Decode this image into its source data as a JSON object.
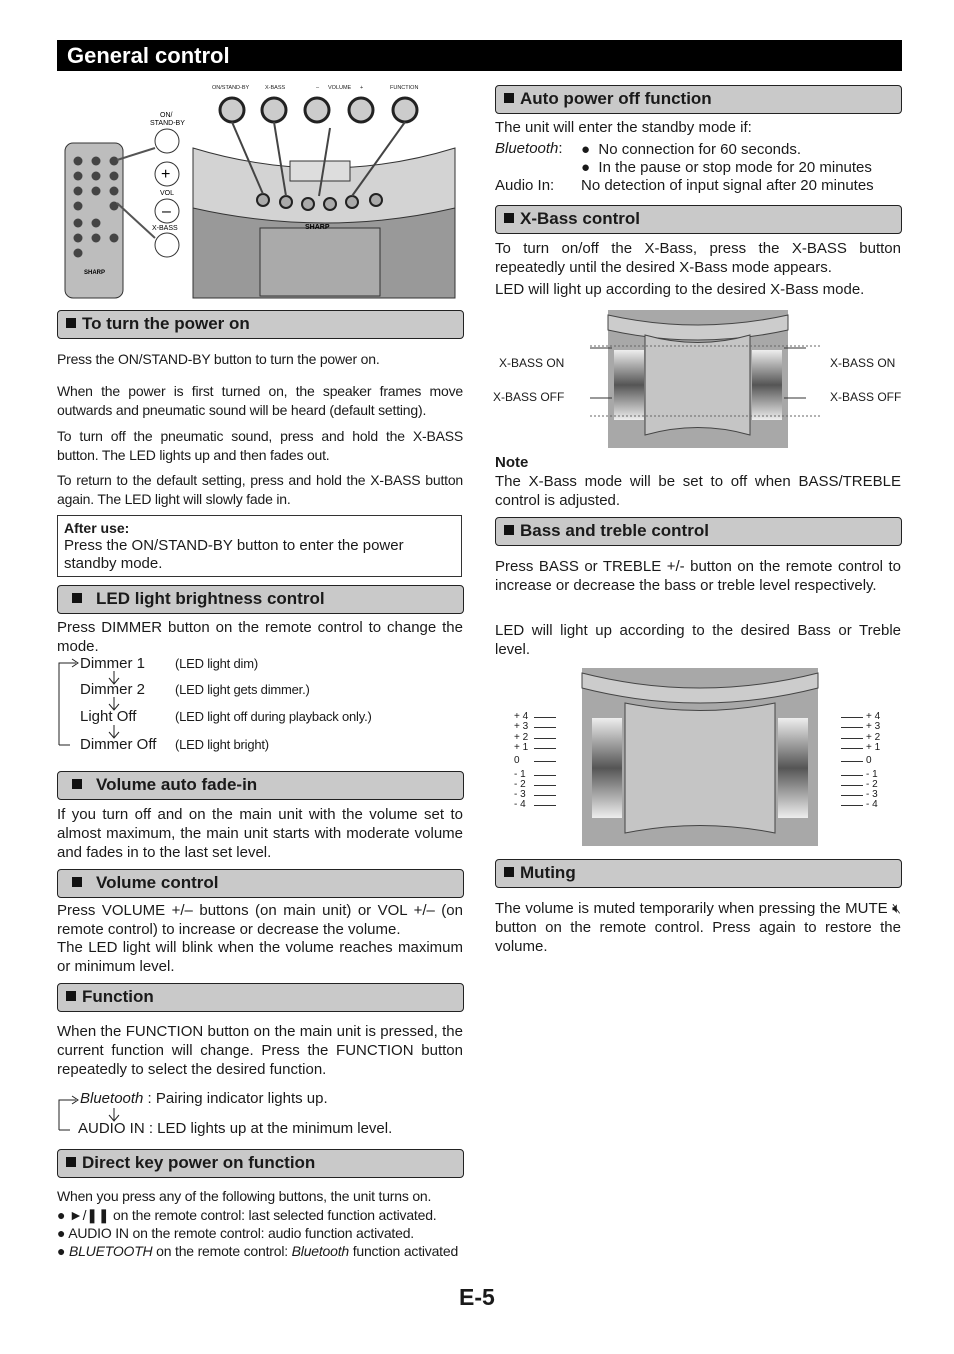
{
  "title": "General control",
  "illustration": {
    "top_labels": [
      "ON/STAND-BY",
      "X-BASS",
      "–",
      "VOLUME",
      "+",
      "FUNCTION"
    ],
    "remote_labels": [
      "ON/\nSTAND-BY",
      "VOL",
      "X-BASS"
    ],
    "brand": "SHARP"
  },
  "power_on": {
    "heading": "To turn the power on",
    "p1": "Press the ON/STAND-BY button to turn the power on.",
    "p2": "When the power is first turned on, the speaker frames move outwards and pneumatic sound will be heard (default setting).",
    "p3": "To turn off the pneumatic sound, press and hold the X-BASS button. The LED lights up and then fades out.",
    "p4": "To return to the default setting, press and hold the X-BASS button again. The LED light will slowly fade in.",
    "after_title": "After use:",
    "after_text": "Press the ON/STAND-BY button to enter the power standby mode."
  },
  "led": {
    "heading": "LED light brightness control",
    "p1": "Press DIMMER button on the remote control to change the mode.",
    "modes": [
      {
        "name": "Dimmer 1",
        "desc": "(LED light dim)"
      },
      {
        "name": "Dimmer 2",
        "desc": "(LED light gets dimmer.)"
      },
      {
        "name": "Light Off",
        "desc": "(LED light off during playback only.)"
      },
      {
        "name": "Dimmer Off",
        "desc": "(LED light bright)"
      }
    ]
  },
  "fade": {
    "heading": "Volume auto fade-in",
    "p1": "If you turn off and on the main unit with the volume set to almost maximum, the main unit starts with moderate volume and fades in to the last set level."
  },
  "volume": {
    "heading": "Volume control",
    "p1": "Press VOLUME +/– buttons (on main unit) or VOL +/– (on remote control) to increase or decrease the volume.",
    "p2": "The LED light will blink when the volume reaches maximum or minimum level."
  },
  "function": {
    "heading": "Function",
    "p1": "When the FUNCTION button on the main unit is pressed, the current function will change. Press the FUNCTION button repeatedly to select the desired function.",
    "bt_name": "Bluetooth",
    "bt_desc": " : Pairing indicator lights up.",
    "audio": "AUDIO IN : LED lights up at the minimum level."
  },
  "direct": {
    "heading": "Direct key power on function",
    "p1": "When you press any of the following buttons, the unit turns on.",
    "b1": "►/❚❚ on the remote control: last selected function activated.",
    "b2": "AUDIO IN on the remote control: audio function activated.",
    "b3a": "BLUETOOTH",
    "b3b": " on the remote control: ",
    "b3c": "Bluetooth",
    "b3d": " function activated"
  },
  "auto_off": {
    "heading": "Auto power off function",
    "p1": "The unit will enter the standby mode if:",
    "bt_label": "Bluetooth",
    "bt_colon": ":",
    "bt1": "No connection for 60 seconds.",
    "bt2": "In the pause or stop mode for 20 minutes",
    "ai_label": "Audio In:",
    "ai_text": "No detection of input signal after 20 minutes"
  },
  "xbass": {
    "heading": "X-Bass control",
    "p1": "To turn on/off the X-Bass, press the X-BASS button repeatedly until the desired X-Bass mode appears.",
    "p2": "LED will light up according to the desired X-Bass mode.",
    "on": "X-BASS ON",
    "off": "X-BASS OFF",
    "note_title": "Note",
    "note": "The X-Bass mode will be set to off when BASS/TREBLE control is adjusted."
  },
  "bass": {
    "heading": "Bass and treble control",
    "p1": "Press BASS or TREBLE +/- button on the remote control to increase or decrease the bass or treble level respectively.",
    "p2": "LED will light up according to the desired Bass or Treble level.",
    "levels": [
      "+ 4",
      "+ 3",
      "+ 2",
      "+ 1",
      "0",
      "- 1",
      "- 2",
      "- 3",
      "- 4"
    ]
  },
  "muting": {
    "heading": "Muting",
    "p1a": "The volume is muted temporarily when pressing the MUTE ",
    "p1b": " button on the remote control. Press again to restore the volume."
  },
  "page_number": "E-5"
}
